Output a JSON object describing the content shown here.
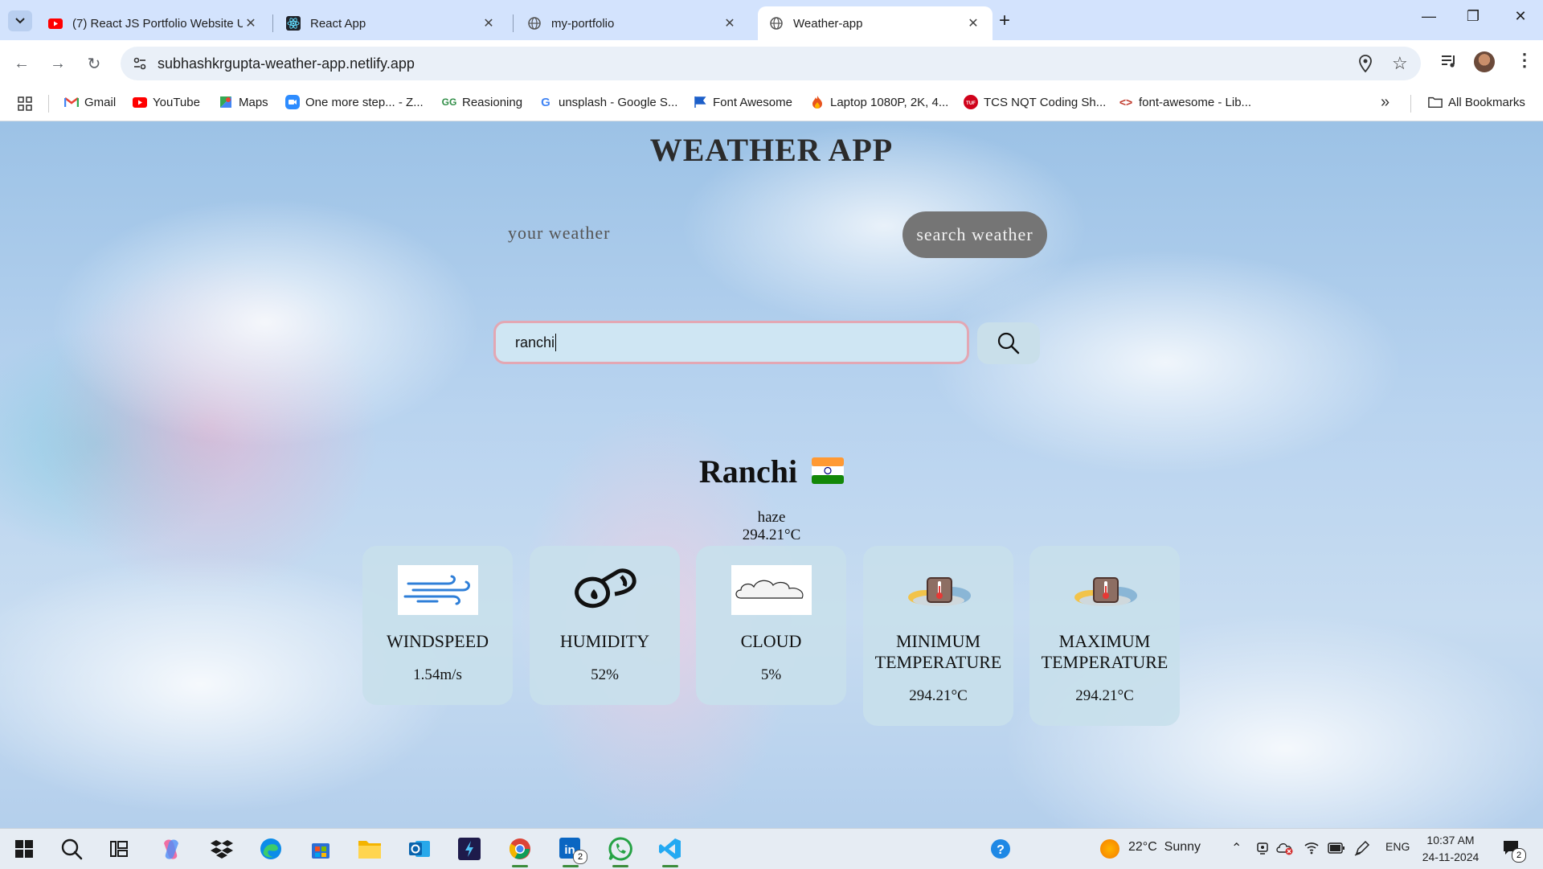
{
  "browser": {
    "tabs": [
      {
        "title": "(7) React JS Portfolio Website U",
        "icon": "youtube-icon"
      },
      {
        "title": "React App",
        "icon": "react-icon"
      },
      {
        "title": "my-portfolio",
        "icon": "globe-icon"
      },
      {
        "title": "Weather-app",
        "icon": "globe-icon",
        "active": true
      }
    ],
    "url": "subhashkrgupta-weather-app.netlify.app",
    "bookmarks": [
      {
        "label": "Gmail",
        "icon": "gmail-icon"
      },
      {
        "label": "YouTube",
        "icon": "youtube-icon"
      },
      {
        "label": "Maps",
        "icon": "maps-icon"
      },
      {
        "label": "One more step... - Z...",
        "icon": "zoom-icon"
      },
      {
        "label": "Reasioning",
        "icon": "gfg-icon"
      },
      {
        "label": "unsplash - Google S...",
        "icon": "google-icon"
      },
      {
        "label": "Font Awesome",
        "icon": "flag-icon"
      },
      {
        "label": "Laptop 1080P, 2K, 4...",
        "icon": "fire-icon"
      },
      {
        "label": "TCS NQT Coding Sh...",
        "icon": "tuf-icon"
      },
      {
        "label": "font-awesome - Lib...",
        "icon": "code-icon"
      }
    ],
    "all_bookmarks": "All Bookmarks"
  },
  "app": {
    "title": "WEATHER APP",
    "your_weather": "your weather",
    "search_weather": "search weather",
    "search_value": "ranchi",
    "city": "Ranchi",
    "country_flag": "india-flag-icon",
    "condition": "haze",
    "temperature": "294.21°C",
    "cards": [
      {
        "label": "WINDSPEED",
        "value": "1.54m/s",
        "icon": "wind-icon"
      },
      {
        "label": "HUMIDITY",
        "value": "52%",
        "icon": "humidity-icon"
      },
      {
        "label": "CLOUD",
        "value": "5%",
        "icon": "cloud-icon"
      },
      {
        "label": "MINIMUM TEMPERATURE",
        "value": "294.21°C",
        "icon": "thermometer-icon"
      },
      {
        "label": "MAXIMUM TEMPERATURE",
        "value": "294.21°C",
        "icon": "thermometer-icon"
      }
    ]
  },
  "taskbar": {
    "weather": "22°C  Sunny",
    "lang": "ENG",
    "time": "10:37 AM",
    "date": "24-11-2024",
    "linkedin_badge": "2",
    "notif_badge": "2"
  }
}
